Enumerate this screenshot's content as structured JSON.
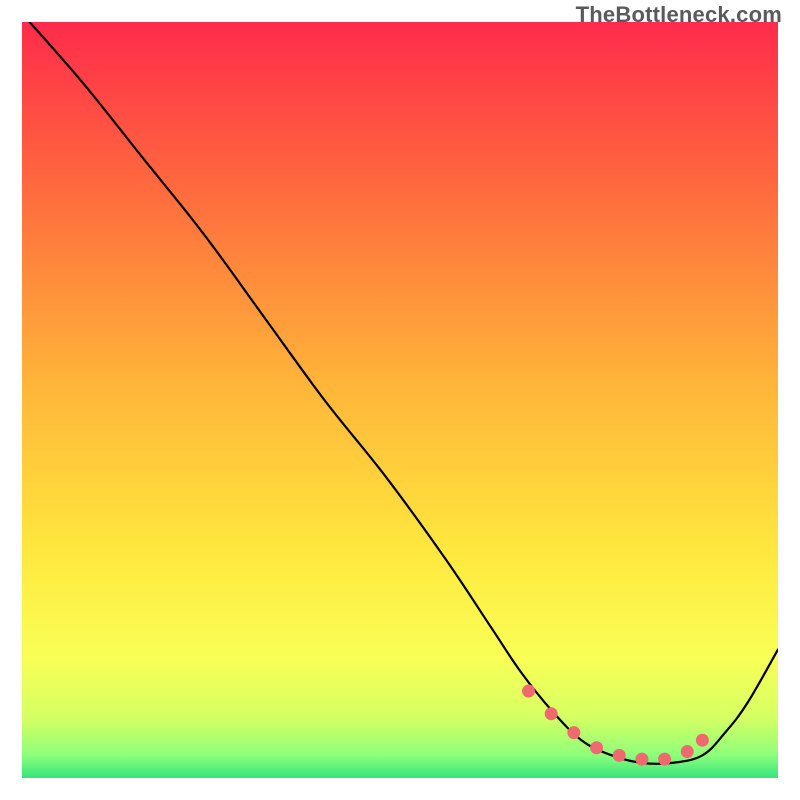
{
  "watermark": "TheBottleneck.com",
  "chart_data": {
    "type": "line",
    "title": "",
    "xlabel": "",
    "ylabel": "",
    "xlim": [
      0,
      100
    ],
    "ylim": [
      0,
      100
    ],
    "grid": false,
    "legend": false,
    "background_gradient": {
      "stops": [
        {
          "pct": 0,
          "color": "#ff2b4b"
        },
        {
          "pct": 22,
          "color": "#ff6a3e"
        },
        {
          "pct": 48,
          "color": "#ffb53a"
        },
        {
          "pct": 70,
          "color": "#ffe83e"
        },
        {
          "pct": 84,
          "color": "#f9ff56"
        },
        {
          "pct": 92,
          "color": "#d6ff63"
        },
        {
          "pct": 97,
          "color": "#8dff7a"
        },
        {
          "pct": 100,
          "color": "#36e57e"
        }
      ]
    },
    "series": [
      {
        "name": "bottleneck-curve",
        "color": "#000000",
        "x": [
          1,
          8,
          16,
          24,
          32,
          40,
          48,
          56,
          62,
          66,
          70,
          74,
          78,
          82,
          86,
          90,
          93,
          96,
          100
        ],
        "y": [
          100,
          92,
          82,
          72,
          61,
          50,
          40,
          29,
          20,
          14,
          9,
          5,
          3,
          2,
          2,
          3,
          6,
          10,
          17
        ]
      },
      {
        "name": "optimal-zone-markers",
        "color": "#ee6a6f",
        "marker": "circle",
        "x": [
          67,
          70,
          73,
          76,
          79,
          82,
          85,
          88,
          90
        ],
        "y": [
          11.5,
          8.5,
          6,
          4,
          3,
          2.5,
          2.5,
          3.5,
          5
        ]
      }
    ],
    "annotations": []
  }
}
